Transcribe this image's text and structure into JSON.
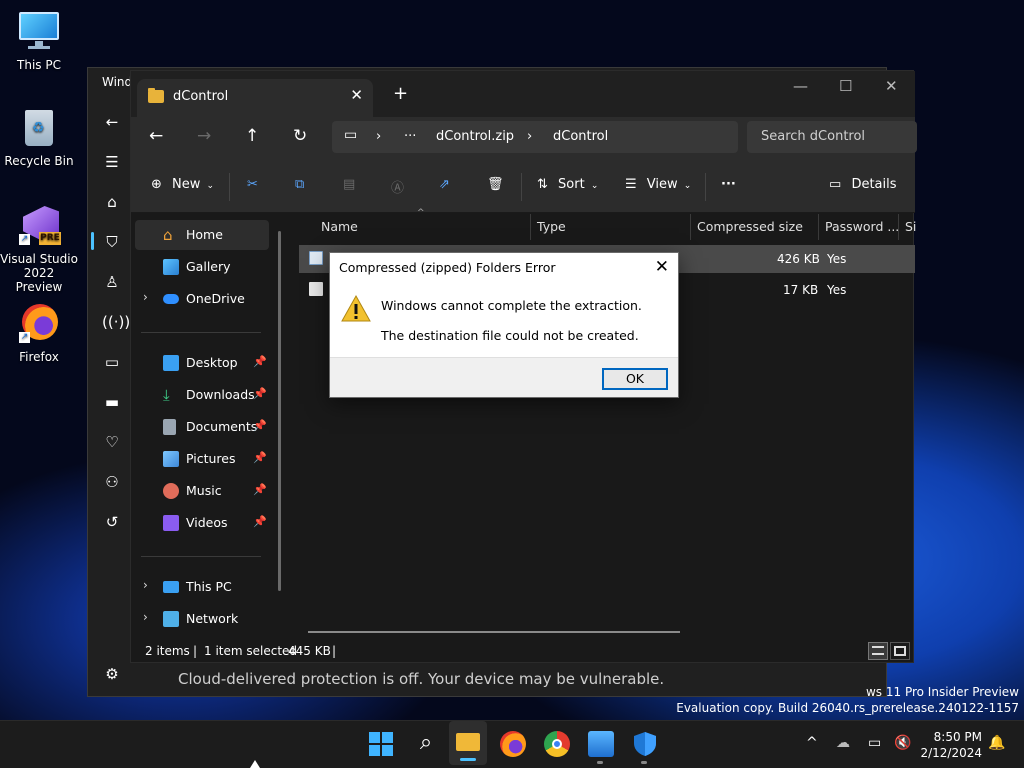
{
  "desktop": {
    "icons": [
      {
        "label": "This PC"
      },
      {
        "label": "Recycle Bin"
      },
      {
        "label": "Visual Studio 2022 Preview",
        "badge": "PRE"
      },
      {
        "label": "Firefox"
      }
    ]
  },
  "background_window": {
    "title": "Wind",
    "banner": "Cloud-delivered protection is off. Your device may be vulnerable."
  },
  "explorer": {
    "tab_title": "dControl",
    "new_tab": "+",
    "address": {
      "ellipsis": "···",
      "crumbs": [
        "dControl.zip",
        "dControl"
      ]
    },
    "search_placeholder": "Search dControl",
    "toolbar": {
      "new_label": "New",
      "sort_label": "Sort",
      "view_label": "View",
      "more_label": "···",
      "details_label": "Details"
    },
    "nav": {
      "home": "Home",
      "gallery": "Gallery",
      "onedrive": "OneDrive",
      "desktop": "Desktop",
      "downloads": "Downloads",
      "documents": "Documents",
      "pictures": "Pictures",
      "music": "Music",
      "videos": "Videos",
      "thispc": "This PC",
      "network": "Network"
    },
    "columns": [
      "Name",
      "Type",
      "Compressed size",
      "Password ...",
      "Si"
    ],
    "rows": [
      {
        "size": "426 KB",
        "password": "Yes"
      },
      {
        "size": "17 KB",
        "password": "Yes"
      }
    ],
    "status": {
      "items": "2 items",
      "selected": "1 item selected",
      "selsize": "445 KB",
      "bar": "|"
    }
  },
  "dialog": {
    "title": "Compressed (zipped) Folders Error",
    "message1": "Windows cannot complete the extraction.",
    "message2": "The destination file could not be created.",
    "ok_label": "OK"
  },
  "watermark": {
    "line1": "ws 11 Pro Insider Preview",
    "line2": "Evaluation copy. Build 26040.rs_prerelease.240122-1157"
  },
  "taskbar": {
    "time": "8:50 PM",
    "date": "2/12/2024"
  },
  "colors": {
    "accent": "#0067c0",
    "folder": "#e8b33a",
    "warning": "#f2c12e"
  }
}
